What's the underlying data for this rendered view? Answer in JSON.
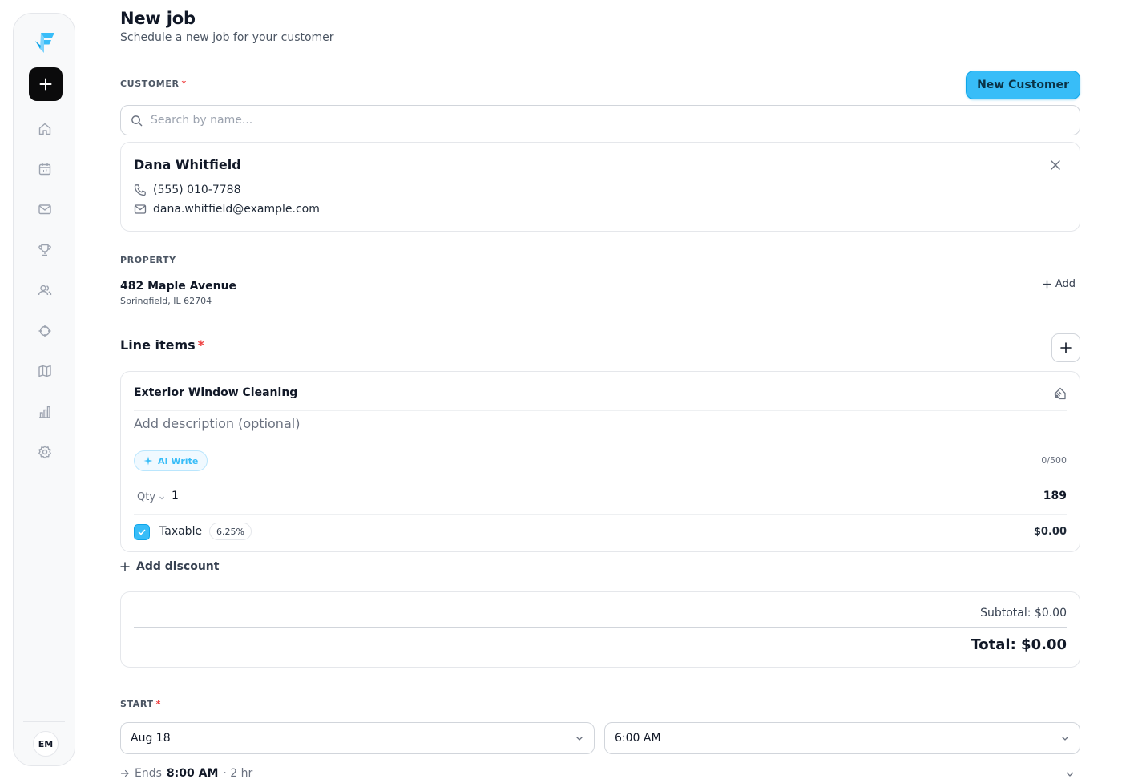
{
  "sidebar": {
    "nav_items": [
      "home",
      "calendar",
      "mail",
      "trophy",
      "users",
      "crosshair",
      "map",
      "chart",
      "settings"
    ],
    "avatar_initials": "EM"
  },
  "page": {
    "title": "New job",
    "subtitle": "Schedule a new job for your customer"
  },
  "customer": {
    "label": "CUSTOMER",
    "required_mark": "*",
    "new_customer_button": "New Customer",
    "search_placeholder": "Search by name...",
    "selected": {
      "name": "Dana Whitfield",
      "phone": "(555) 010-7788",
      "email": "dana.whitfield@example.com"
    }
  },
  "property": {
    "label": "PROPERTY",
    "name": "482 Maple Avenue",
    "address": "Springfield, IL 62704",
    "add_label": "Add"
  },
  "line_items": {
    "title": "Line items",
    "required_mark": "*",
    "item": {
      "name": "Exterior Window Cleaning",
      "description_placeholder": "Add description (optional)",
      "ai_write_label": "AI Write",
      "char_count": "0/500",
      "qty_label": "Qty",
      "qty_value": "1",
      "price": "189",
      "taxable_label": "Taxable",
      "taxable_checked": true,
      "tax_rate": "6.25%",
      "tax_amount": "$0.00"
    },
    "add_discount_label": "Add discount"
  },
  "totals": {
    "subtotal": "Subtotal: $0.00",
    "total": "Total: $0.00"
  },
  "start": {
    "label": "START",
    "required_mark": "*",
    "date": "Aug 18",
    "time": "6:00 AM",
    "ends_prefix": "Ends",
    "ends_time": "8:00 AM",
    "ends_duration": "· 2 hr"
  },
  "colors": {
    "accent": "#38bdf8",
    "accent_border": "#0ea5e9",
    "required": "#ef4444",
    "primary_dark": "#0b0b0c"
  }
}
